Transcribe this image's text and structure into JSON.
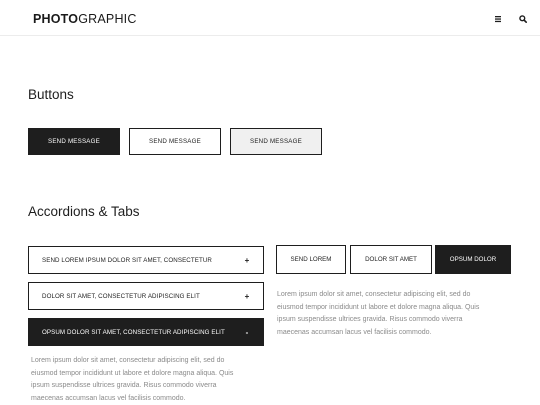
{
  "header": {
    "logo_bold": "PHOTO",
    "logo_light": "GRAPHIC",
    "menu_icon": "hamburger-icon",
    "search_icon": "search-icon"
  },
  "buttons_section": {
    "title": "Buttons",
    "buttons": [
      {
        "label": "SEND MESSAGE",
        "style": "dark"
      },
      {
        "label": "SEND MESSAGE",
        "style": "outline"
      },
      {
        "label": "SEND MESSAGE",
        "style": "light"
      }
    ]
  },
  "accordions_section": {
    "title": "Accordions & Tabs",
    "accordions": [
      {
        "label": "SEND LOREM IPSUM DOLOR SIT AMET, CONSECTETUR",
        "sign": "+",
        "expanded": false
      },
      {
        "label": "DOLOR SIT AMET, CONSECTETUR ADIPISCING ELIT",
        "sign": "+",
        "expanded": false
      },
      {
        "label": "OPSUM DOLOR SIT AMET, CONSECTETUR ADIPISCING ELIT",
        "sign": "-",
        "expanded": true
      }
    ],
    "accordion_text": [
      "Lorem ipsum dolor sit amet, consectetur adipiscing elit, sed do",
      "eiusmod tempor incididunt ut labore et dolore magna aliqua. Quis",
      "ipsum suspendisse ultrices gravida. Risus commodo viverra",
      "maecenas accumsan lacus vel facilisis commodo."
    ],
    "tabs": [
      {
        "label": "SEND LOREM",
        "active": false
      },
      {
        "label": "DOLOR SIT AMET",
        "active": false
      },
      {
        "label": "OPSUM DOLOR",
        "active": true
      }
    ],
    "tab_text": [
      "Lorem ipsum dolor sit amet, consectetur adipiscing elit, sed do",
      "eiusmod tempor incididunt ut labore et dolore magna aliqua. Quis",
      "ipsum suspendisse ultrices gravida. Risus commodo viverra",
      "maecenas accumsan lacus vel facilisis commodo."
    ]
  },
  "colors": {
    "dark": "#1e1e1e",
    "light_button": "#f0f0f0",
    "body_text": "#8a8a8a"
  }
}
